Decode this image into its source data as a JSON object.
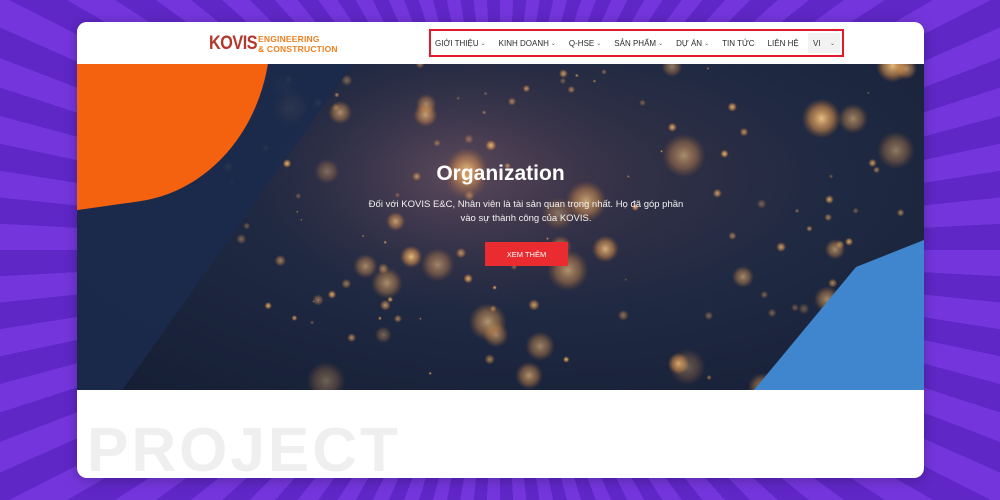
{
  "brand": {
    "logo_mark": "KOVIS",
    "logo_line1": "ENGINEERING",
    "logo_line2": "& CONSTRUCTION"
  },
  "nav": {
    "items": [
      {
        "label": "GIỚI THIỆU",
        "has_dropdown": true
      },
      {
        "label": "KINH DOANH",
        "has_dropdown": true
      },
      {
        "label": "Q-HSE",
        "has_dropdown": true
      },
      {
        "label": "SẢN PHẨM",
        "has_dropdown": true
      },
      {
        "label": "DỰ ÁN",
        "has_dropdown": true
      },
      {
        "label": "TIN TỨC",
        "has_dropdown": false
      },
      {
        "label": "LIÊN HỆ",
        "has_dropdown": false
      }
    ],
    "language": "VI"
  },
  "hero": {
    "title": "Organization",
    "description": "Đối với KOVIS E&C, Nhân viên là tài sản quan trọng nhất. Họ đã góp phần vào sự thành công của KOVIS.",
    "button_label": "XEM THÊM"
  },
  "section": {
    "watermark": "PROJECT"
  },
  "colors": {
    "accent_red": "#ea2b2f",
    "brand_orange": "#f0801e",
    "hero_orange": "#f4620f",
    "hero_blue": "#3f86cf",
    "nav_highlight": "#e21a2a"
  },
  "icons": {
    "dropdown": "chevron-down-icon"
  }
}
